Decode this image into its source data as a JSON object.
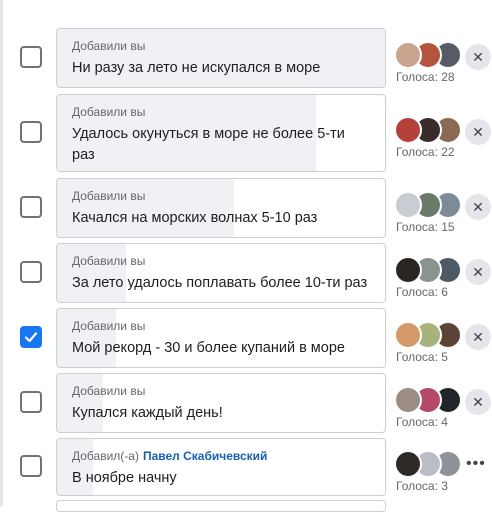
{
  "options": [
    {
      "added_by": "Добавили вы",
      "author": "",
      "text": "Ни разу за лето не искупался в море",
      "votes": "Голоса: 28",
      "vote_fraction": 1.0,
      "checked": false,
      "action": "remove",
      "voter_colors": [
        "#c9a48e",
        "#b3553e",
        "#555c66"
      ]
    },
    {
      "added_by": "Добавили вы",
      "author": "",
      "text": "Удалось окунуться в море не более 5-ти раз",
      "votes": "Голоса: 22",
      "vote_fraction": 0.79,
      "checked": false,
      "action": "remove",
      "voter_colors": [
        "#b5413b",
        "#3a2c28",
        "#8a6a52"
      ]
    },
    {
      "added_by": "Добавили вы",
      "author": "",
      "text": "Качался на морских волнах 5-10 раз",
      "votes": "Голоса: 15",
      "vote_fraction": 0.54,
      "checked": false,
      "action": "remove",
      "voter_colors": [
        "#c9ccd1",
        "#6c7a6a",
        "#7d8b98"
      ]
    },
    {
      "added_by": "Добавили вы",
      "author": "",
      "text": "За лето удалось поплавать более 10-ти раз",
      "votes": "Голоса: 6",
      "vote_fraction": 0.21,
      "checked": false,
      "action": "remove",
      "voter_colors": [
        "#2a2624",
        "#8a948e",
        "#4d5a66"
      ]
    },
    {
      "added_by": "Добавили вы",
      "author": "",
      "text": "Мой рекорд - 30 и более купаний в море",
      "votes": "Голоса: 5",
      "vote_fraction": 0.18,
      "checked": true,
      "action": "remove",
      "voter_colors": [
        "#d59a6c",
        "#a6b37a",
        "#5b4336"
      ]
    },
    {
      "added_by": "Добавили вы",
      "author": "",
      "text": "Купался каждый день!",
      "votes": "Голоса: 4",
      "vote_fraction": 0.14,
      "checked": false,
      "action": "remove",
      "voter_colors": [
        "#9c8d84",
        "#b44a68",
        "#20262b"
      ]
    },
    {
      "added_by": "Добавил(-а)",
      "author": "Павел Скабичевский",
      "text": "В ноябре начну",
      "votes": "Голоса: 3",
      "vote_fraction": 0.11,
      "checked": false,
      "action": "more",
      "voter_colors": [
        "#2e2a28",
        "#b9bec4",
        "#8c949b"
      ]
    }
  ],
  "icons": {
    "remove": "close-icon",
    "more": "more-icon",
    "check": "check-icon"
  },
  "glyphs": {
    "remove": "✕",
    "more": "•••"
  },
  "colors": {
    "accent": "#1877f2",
    "bar_fill": "#eff1f5",
    "border": "#ccd0d5"
  }
}
